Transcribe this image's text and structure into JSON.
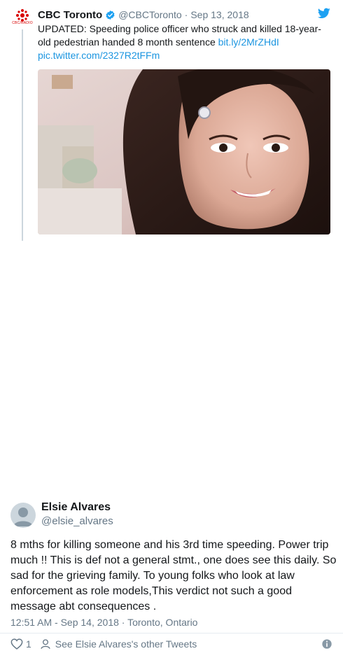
{
  "quoted_tweet": {
    "logo_text": "CBC/RADIO",
    "author_name": "CBC Toronto",
    "handle": "@CBCToronto",
    "separator": "·",
    "date": "Sep 13, 2018",
    "text_main": "UPDATED: Speeding police officer who struck and killed 18-year-old pedestrian handed 8 month sentence ",
    "short_link": "bit.ly/2MrZHdI",
    "pic_link": "pic.twitter.com/2327R2tFFm"
  },
  "reply_tweet": {
    "author_name": "Elsie Alvares",
    "handle": "@elsie_alvares",
    "text": "8 mths for killing someone and his 3rd time speeding. Power trip much !! This is def not a general stmt., one does see this daily. So sad for the grieving family. To young folks who look at law enforcement as role models,This verdict not such a good message abt consequences .",
    "meta": "12:51 AM - Sep 14, 2018 · Toronto, Ontario",
    "like_count": "1",
    "see_other_label": "See Elsie Alvares's other Tweets"
  },
  "colors": {
    "text": "#14171a",
    "secondary": "#657786",
    "link": "#1b95e0",
    "verified": "#1da1f2",
    "cbc_red": "#d80000"
  },
  "icons": [
    "cbc-gem-icon",
    "verified-badge-icon",
    "twitter-bird-icon",
    "heart-icon",
    "person-icon",
    "info-icon"
  ]
}
